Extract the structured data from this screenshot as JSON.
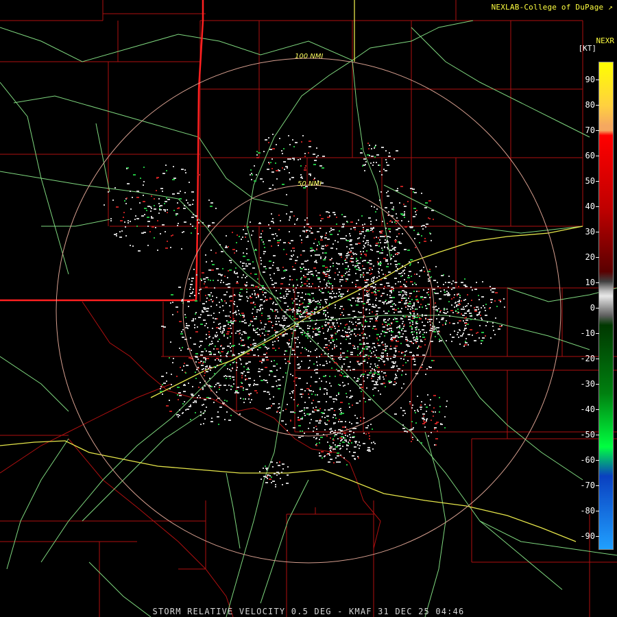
{
  "header": {
    "credit": "NEXLAB-College of DuPage",
    "credit_icon": "external-link-icon"
  },
  "legend": {
    "product": "NEXR",
    "units": "[KT]",
    "ticks": [
      "90",
      "80",
      "70",
      "60",
      "50",
      "40",
      "30",
      "20",
      "10",
      "0",
      "-10",
      "-20",
      "-30",
      "-40",
      "-50",
      "-60",
      "-70",
      "-80",
      "-90"
    ],
    "colors": {
      "top": "#ffff00",
      "orange": "#f5a860",
      "red": "#ff0000",
      "darkred": "#5a0000",
      "gray": "#c0c0c0",
      "darkgreen": "#003800",
      "green": "#00ff40",
      "blue": "#0a40c0",
      "lightblue": "#20a0ff"
    }
  },
  "map": {
    "range_rings": [
      {
        "label": "50 NMI"
      },
      {
        "label": "100 NMI"
      }
    ],
    "colors": {
      "county_lines": "#b01010",
      "state_line": "#ff2020",
      "roads": "#7fd87f",
      "interstate": "#e6e64a",
      "rings": "#d8a090",
      "echo_gray": "#d0d0d0",
      "echo_red": "#c02020",
      "echo_green": "#20c040"
    }
  },
  "footer": {
    "caption": "STORM RELATIVE VELOCITY 0.5 DEG - KMAF 31 DEC 25 04:46"
  }
}
